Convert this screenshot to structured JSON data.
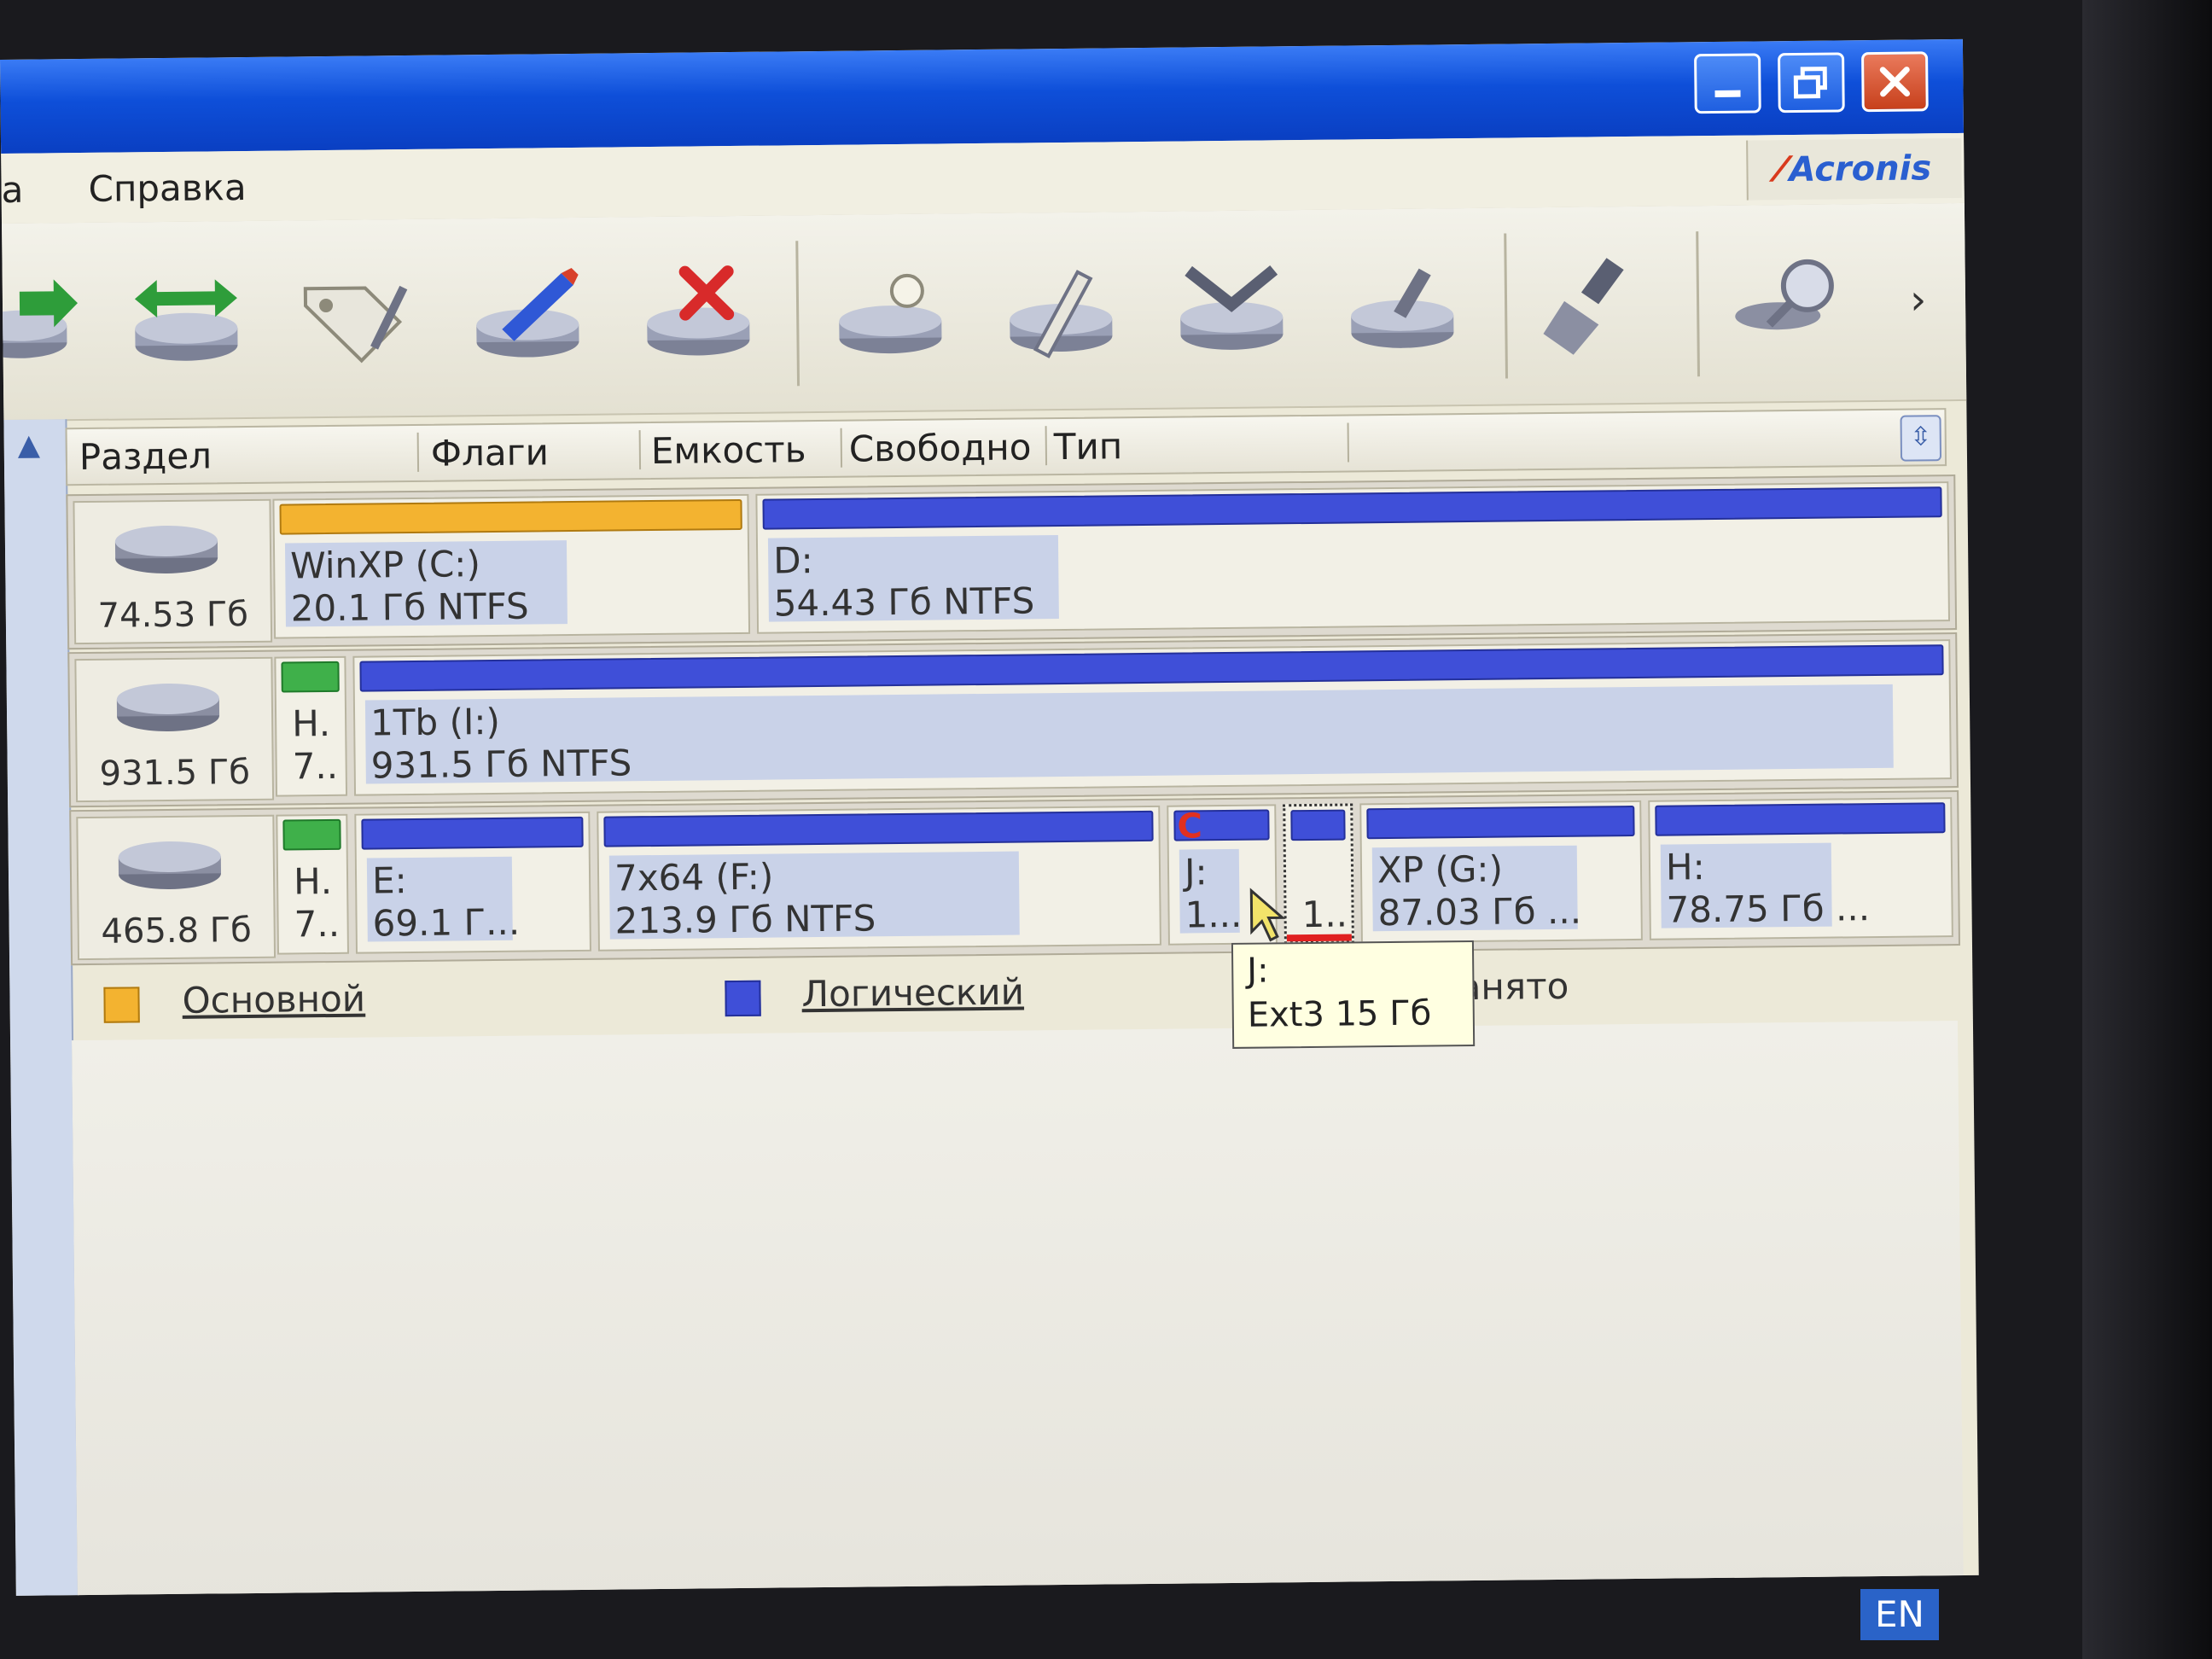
{
  "menu": {
    "partial_left": "а",
    "help": "Справка"
  },
  "brand": {
    "logo_text": "Acronis"
  },
  "columns": {
    "partition": "Раздел",
    "flags": "Флаги",
    "capacity": "Емкость",
    "free": "Свободно",
    "type": "Тип"
  },
  "disks": [
    {
      "size": "74.53 Гб",
      "partitions": [
        {
          "line1": "WinXP (C:)",
          "line2": "20.1 Гб  NTFS",
          "kind": "primary"
        },
        {
          "line1": "D:",
          "line2": "54.43 Гб  NTFS",
          "kind": "logical"
        }
      ]
    },
    {
      "size": "931.5 Гб",
      "partitions": [
        {
          "line1": "Н.",
          "line2": "7..",
          "kind": "hidden"
        },
        {
          "line1": "1Tb (I:)",
          "line2": "931.5 Гб  NTFS",
          "kind": "logical"
        }
      ]
    },
    {
      "size": "465.8 Гб",
      "partitions": [
        {
          "line1": "Н.",
          "line2": "7..",
          "kind": "hidden"
        },
        {
          "line1": "E:",
          "line2": "69.1 Г...",
          "kind": "logical"
        },
        {
          "line1": "7x64 (F:)",
          "line2": "213.9 Гб  NTFS",
          "kind": "logical"
        },
        {
          "line1": "J:",
          "line2": "1...",
          "kind": "logical"
        },
        {
          "line1": "",
          "line2": "1..",
          "kind": "logical"
        },
        {
          "line1": "XP (G:)",
          "line2": "87.03 Гб  ...",
          "kind": "logical"
        },
        {
          "line1": "H:",
          "line2": "78.75 Гб  ...",
          "kind": "logical"
        }
      ]
    }
  ],
  "legend": {
    "primary": "Основной",
    "logical": "Логический",
    "unallocated_partial": "езанято"
  },
  "tooltip": {
    "line1": "J:",
    "line2": "Ext3 15 Гб"
  },
  "taskbar": {
    "language": "EN"
  },
  "colors": {
    "primary": "#f3b330",
    "logical": "#3f4fd8",
    "hidden": "#3fb04a",
    "titlebar": "#0e4fd9"
  },
  "icons": [
    "copy-partition-icon",
    "move-partition-icon",
    "label-partition-icon",
    "edit-partition-icon",
    "delete-partition-icon",
    "create-partition-icon",
    "split-partition-icon",
    "merge-partition-icon",
    "convert-partition-icon",
    "clean-icon",
    "search-icon"
  ]
}
